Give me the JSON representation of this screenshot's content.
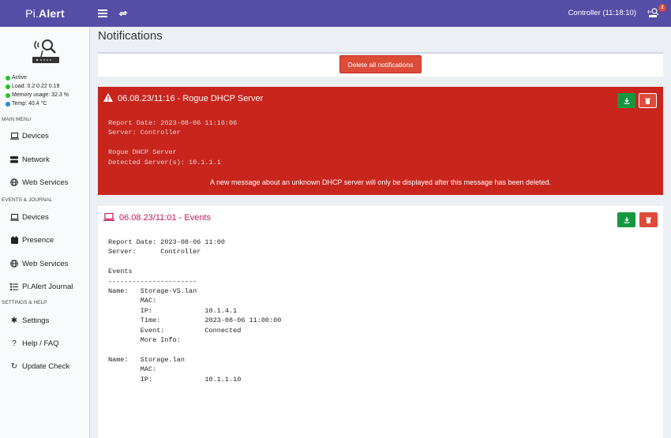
{
  "app": {
    "logo_left": "Pi.",
    "logo_right": "Alert",
    "controller_status": "Controller (11:18:10)",
    "notification_count": "2"
  },
  "sidebar": {
    "status": [
      {
        "label": "Active",
        "color": "#23c42a"
      },
      {
        "label": "Load: 0.2  0.22  0.19",
        "color": "#23c42a"
      },
      {
        "label": "Memory usage: 32.3 %",
        "color": "#23c42a"
      },
      {
        "label": "Temp: 40.4 °C",
        "color": "#1f8ccf"
      }
    ],
    "sections": [
      "MAIN MENU",
      "EVENTS & JOURNAL",
      "SETTINGS & HELP"
    ],
    "items": [
      {
        "label": "Devices",
        "icon": "laptop-icon"
      },
      {
        "label": "Network",
        "icon": "server-icon"
      },
      {
        "label": "Web Services",
        "icon": "globe-icon"
      },
      {
        "label": "Devices",
        "icon": "laptop-icon"
      },
      {
        "label": "Presence",
        "icon": "calendar-icon"
      },
      {
        "label": "Web Services",
        "icon": "globe-icon"
      },
      {
        "label": "Pi.Alert Journal",
        "icon": "list-icon"
      },
      {
        "label": "Settings",
        "icon": "gear-icon"
      },
      {
        "label": "Help / FAQ",
        "icon": "question-icon"
      },
      {
        "label": "Update Check",
        "icon": "refresh-icon"
      }
    ]
  },
  "main": {
    "title": "Notifications",
    "delete_all_label": "Delete all notifications",
    "notifications": [
      {
        "title": "06.08.23/11:16 - Rogue DHCP Server",
        "icon": "warning-icon",
        "accent": "#c8251d",
        "body": "Report Date: 2023-08-06 11:16:06\nServer: Controller\n\nRogue DHCP Server\nDetected Server(s): 10.1.1.1",
        "note": "A new message about an unknown DHCP server will only be displayed after this message has been deleted."
      },
      {
        "title": "06.08.23/11:01 - Events",
        "icon": "laptop-icon",
        "accent": "#c2185b",
        "body": "Report Date: 2023-08-06 11:00\nServer:      Controller\n\nEvents\n----------------------\nName:   Storage-VS.lan\n        MAC:\n        IP:             10.1.4.1\n        Time:           2023-08-06 11:00:00\n        Event:          Connected\n        More Info:\n\nName:   Storage.lan\n        MAC:\n        IP:             10.1.1.10"
      }
    ]
  }
}
